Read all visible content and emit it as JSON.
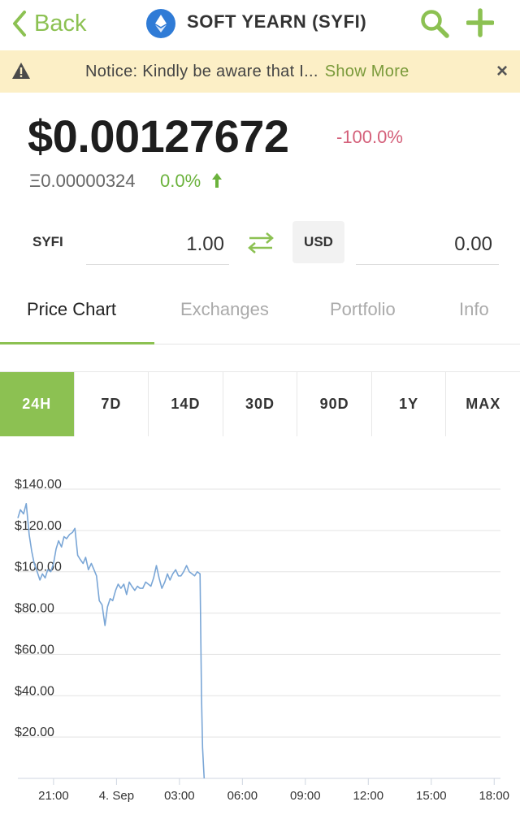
{
  "header": {
    "back_label": "Back",
    "title": "SOFT YEARN (SYFI)",
    "accent_color": "#8cc152"
  },
  "notice": {
    "text": "Notice: Kindly be aware that I...",
    "more_label": "Show More",
    "close_glyph": "×"
  },
  "price": {
    "usd": "$0.00127672",
    "change_24h": "-100.0%",
    "eth": "Ξ0.00000324",
    "eth_change": "0.0%"
  },
  "converter": {
    "from_symbol": "SYFI",
    "from_value": "1.00",
    "to_symbol": "USD",
    "to_value": "0.00"
  },
  "tabs": [
    {
      "label": "Price Chart",
      "active": true
    },
    {
      "label": "Exchanges",
      "active": false
    },
    {
      "label": "Portfolio",
      "active": false
    },
    {
      "label": "Info",
      "active": false
    }
  ],
  "ranges": [
    {
      "label": "24H",
      "active": true
    },
    {
      "label": "7D",
      "active": false
    },
    {
      "label": "14D",
      "active": false
    },
    {
      "label": "30D",
      "active": false
    },
    {
      "label": "90D",
      "active": false
    },
    {
      "label": "1Y",
      "active": false
    },
    {
      "label": "MAX",
      "active": false
    }
  ],
  "chart_data": {
    "type": "line",
    "ylim": [
      0,
      140
    ],
    "y_ticks": [
      140,
      120,
      100,
      80,
      60,
      40,
      20
    ],
    "y_tick_labels": [
      "$140.00",
      "$120.00",
      "$100.00",
      "$80.00",
      "$60.00",
      "$40.00",
      "$20.00"
    ],
    "xlim": [
      19.3,
      42.3
    ],
    "x_ticks": [
      21,
      24,
      27,
      30,
      33,
      36,
      39,
      42
    ],
    "x_tick_labels": [
      "21:00",
      "4. Sep",
      "03:00",
      "06:00",
      "09:00",
      "12:00",
      "15:00",
      "18:00"
    ],
    "line_color": "#7aa6d6",
    "grid": true,
    "series": [
      {
        "x": [
          19.3,
          19.42,
          19.57,
          19.7,
          19.84,
          19.96,
          20.08,
          20.22,
          20.35,
          20.47,
          20.6,
          20.72,
          20.87,
          21.0,
          21.12,
          21.24,
          21.38,
          21.5,
          21.62,
          21.76,
          21.9,
          22.02,
          22.15,
          22.27,
          22.41,
          22.53,
          22.66,
          22.8,
          22.93,
          23.05,
          23.18,
          23.31,
          23.45,
          23.57,
          23.7,
          23.82,
          23.96,
          24.08,
          24.21,
          24.35,
          24.48,
          24.61,
          24.73,
          24.87,
          25.0,
          25.12,
          25.25,
          25.39,
          25.52,
          25.64,
          25.77,
          25.9,
          26.03,
          26.16,
          26.3,
          26.43,
          26.55,
          26.68,
          26.82,
          26.95,
          27.07,
          27.2,
          27.34,
          27.47,
          27.6,
          27.72,
          27.85,
          27.98,
          28.05,
          28.1,
          28.15,
          28.18
        ],
        "y": [
          126,
          130,
          128,
          133,
          118,
          110,
          104,
          100,
          96,
          99,
          97,
          101,
          100,
          104,
          111,
          115,
          112,
          117,
          116,
          118,
          119,
          121,
          108,
          106,
          104,
          107,
          101,
          104,
          101,
          98,
          86,
          84,
          74,
          83,
          87,
          86,
          91,
          94,
          92,
          94,
          89,
          95,
          93,
          91,
          93,
          92,
          92,
          95,
          94,
          93,
          97,
          103,
          97,
          92,
          95,
          99,
          96,
          99,
          101,
          98,
          98,
          100,
          103,
          100,
          99,
          98,
          100,
          99,
          40,
          15,
          5,
          0
        ]
      }
    ]
  }
}
